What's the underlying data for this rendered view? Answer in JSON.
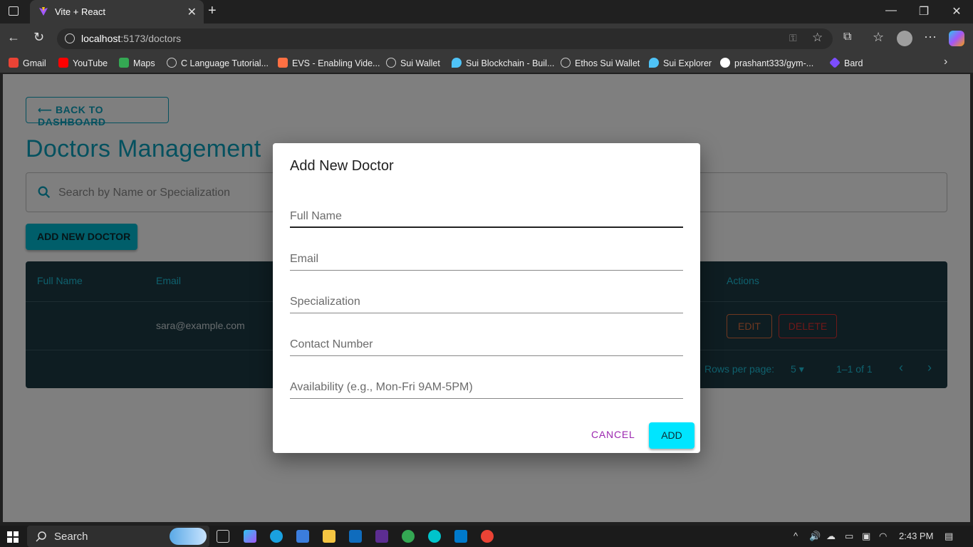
{
  "browser": {
    "tab_title": "Vite + React",
    "url_host": "localhost",
    "url_path": ":5173/doctors",
    "bookmarks": [
      {
        "label": "Gmail",
        "color": "#ea4335"
      },
      {
        "label": "YouTube",
        "color": "#ff0000"
      },
      {
        "label": "Maps",
        "color": "#34a853"
      },
      {
        "label": "C Language Tutorial...",
        "color": "#9e9e9e"
      },
      {
        "label": "EVS - Enabling Vide...",
        "color": "#ff7043"
      },
      {
        "label": "Sui Wallet",
        "color": "#9e9e9e"
      },
      {
        "label": "Sui Blockchain - Buil...",
        "color": "#4fc3f7"
      },
      {
        "label": "Ethos Sui Wallet",
        "color": "#9e9e9e"
      },
      {
        "label": "Sui Explorer",
        "color": "#4fc3f7"
      },
      {
        "label": "prashant333/gym-...",
        "color": "#ffffff"
      },
      {
        "label": "Bard",
        "color": "#7c4dff"
      }
    ]
  },
  "page": {
    "back_label": "⟵ BACK TO DASHBOARD",
    "title": "Doctors Management",
    "search_placeholder": "Search by Name or Specialization",
    "add_button": "ADD NEW DOCTOR",
    "table": {
      "headers": {
        "name": "Full Name",
        "email": "Email",
        "actions": "Actions"
      },
      "rows": [
        {
          "name": "",
          "email": "sara@example.com",
          "edit": "EDIT",
          "delete": "DELETE"
        }
      ],
      "footer": {
        "rows_per_page_label": "Rows per page:",
        "rows_per_page": "5",
        "range": "1–1 of 1"
      }
    }
  },
  "dialog": {
    "title": "Add New Doctor",
    "fields": [
      {
        "label": "Full Name"
      },
      {
        "label": "Email"
      },
      {
        "label": "Specialization"
      },
      {
        "label": "Contact Number"
      },
      {
        "label": "Availability (e.g., Mon-Fri 9AM-5PM)"
      }
    ],
    "cancel": "CANCEL",
    "add": "ADD"
  },
  "taskbar": {
    "search": "Search",
    "time": "2:43 PM"
  }
}
